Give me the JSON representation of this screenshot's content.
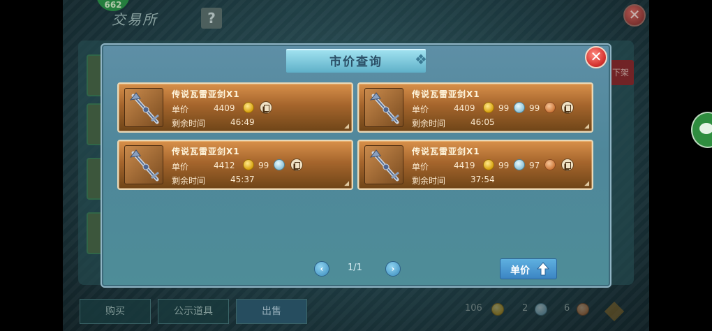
{
  "background": {
    "badge_text": "662",
    "title": "交易所",
    "help_label": "?",
    "close_label": "✕",
    "side_action_label": "下架",
    "tabs": [
      {
        "label": "购买"
      },
      {
        "label": "公示道具"
      },
      {
        "label": "出售"
      }
    ],
    "currencies": [
      {
        "amount": "106",
        "icon": "gold-coin-icon"
      },
      {
        "amount": "2",
        "icon": "silver-coin-icon"
      },
      {
        "amount": "6",
        "icon": "copper-coin-icon"
      }
    ]
  },
  "modal": {
    "title": "市价查询",
    "close_label": "✕",
    "labels": {
      "price": "单价",
      "remaining_time": "剩余时间"
    },
    "listings": [
      {
        "name": "传说瓦雷亚剑X1",
        "gold": "4409",
        "silver": "",
        "copper": "",
        "time": "46:49"
      },
      {
        "name": "传说瓦雷亚剑X1",
        "gold": "4409",
        "silver": "99",
        "copper": "99",
        "time": "46:05"
      },
      {
        "name": "传说瓦雷亚剑X1",
        "gold": "4412",
        "silver": "99",
        "copper": "",
        "time": "45:37"
      },
      {
        "name": "传说瓦雷亚剑X1",
        "gold": "4419",
        "silver": "99",
        "copper": "97",
        "time": "37:54"
      }
    ],
    "pager": {
      "prev": "‹",
      "next": "›",
      "text": "1/1"
    },
    "sort_button": {
      "label": "单价"
    }
  },
  "colors": {
    "card_border": "#e9d9b8",
    "modal_bg": "#4f879a",
    "close_red": "#d4322e",
    "sort_blue": "#3b85c3"
  }
}
